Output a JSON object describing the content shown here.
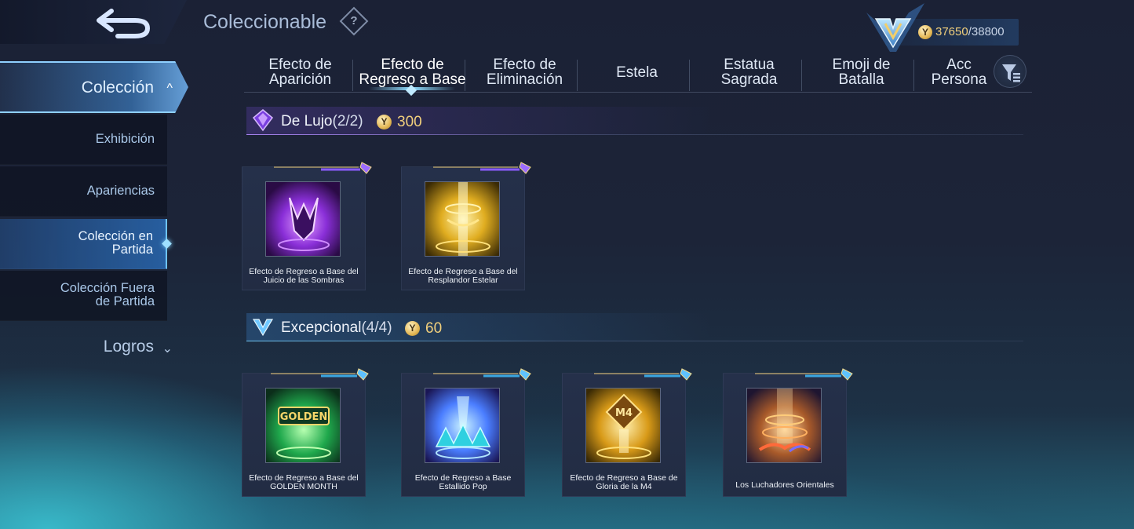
{
  "header": {
    "back_icon": "back-arrow-icon",
    "title": "Coleccionable",
    "help_icon": "question-diamond-icon",
    "currency": {
      "current": "37650",
      "separator": "/",
      "max": "38800",
      "coin_symbol": "Y"
    }
  },
  "sidebar": {
    "collection": {
      "label": "Colección",
      "chevron": "^"
    },
    "items": [
      {
        "label": "Exhibición"
      },
      {
        "label": "Apariencias"
      },
      {
        "label_line1": "Colección en",
        "label_line2": "Partida"
      },
      {
        "label_line1": "Colección Fuera",
        "label_line2": "de Partida"
      }
    ],
    "active_item": "Colección en Partida",
    "logros": {
      "label": "Logros",
      "chevron": "⌄"
    }
  },
  "tabs": [
    {
      "line1": "Efecto de",
      "line2": "Aparición"
    },
    {
      "line1": "Efecto de",
      "line2": "Regreso a Base"
    },
    {
      "line1": "Efecto de",
      "line2": "Eliminación"
    },
    {
      "line1": "Estela",
      "line2": ""
    },
    {
      "line1": "Estatua",
      "line2": "Sagrada"
    },
    {
      "line1": "Emoji de",
      "line2": "Batalla"
    },
    {
      "line1": "Acc",
      "line2": "Persona"
    }
  ],
  "active_tab": "Efecto de Regreso a Base",
  "sections": [
    {
      "name": "De Lujo",
      "count": "(2/2)",
      "price": "300",
      "accent": "#a070ff",
      "items": [
        {
          "caption_line1": "Efecto de Regreso a Base del",
          "caption_line2": "Juicio de las Sombras",
          "theme": [
            "#2a0b45",
            "#9a34e6"
          ]
        },
        {
          "caption_line1": "Efecto de Regreso a Base del",
          "caption_line2": "Resplandor Estelar",
          "theme": [
            "#3a2a05",
            "#f0c030"
          ]
        }
      ]
    },
    {
      "name": "Excepcional",
      "count": "(4/4)",
      "price": "60",
      "accent": "#6fc8ff",
      "items": [
        {
          "caption_line1": "Efecto de Regreso a Base del",
          "caption_line2": "GOLDEN MONTH",
          "theme": [
            "#0b2e1a",
            "#2fd66a"
          ],
          "art_text": "GOLDEN"
        },
        {
          "caption_line1": "Efecto de Regreso a Base",
          "caption_line2": "Estallido Pop",
          "theme": [
            "#1a1655",
            "#47b6ff"
          ]
        },
        {
          "caption_line1": "Efecto de Regreso a Base de",
          "caption_line2": "Gloria de la M4",
          "theme": [
            "#3a2a05",
            "#f0b020"
          ],
          "art_text": "M4"
        },
        {
          "caption_line1": "Los Luchadores Orientales",
          "caption_line2": "",
          "theme": [
            "#2a1a2a",
            "#ff8a2a"
          ]
        }
      ]
    }
  ]
}
